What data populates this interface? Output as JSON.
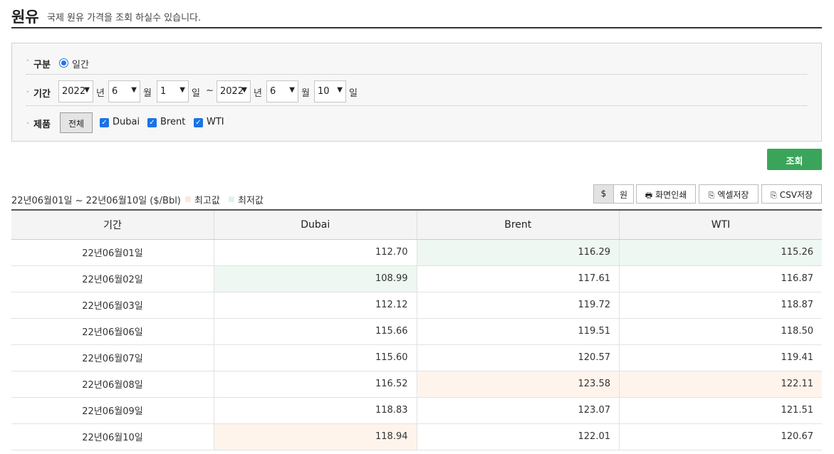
{
  "header": {
    "title": "원유",
    "description": "국제 원유 가격을 조회 하실수 있습니다."
  },
  "search": {
    "category_label": "구분",
    "category_value": "일간",
    "period_label": "기간",
    "start_year": "2022",
    "start_month": "6",
    "start_day": "1",
    "end_year": "2022",
    "end_month": "6",
    "end_day": "10",
    "unit_year": "년",
    "unit_month": "월",
    "unit_day": "일",
    "tilde": "~",
    "product_label": "제품",
    "all_button": "전체",
    "products": [
      "Dubai",
      "Brent",
      "WTI"
    ]
  },
  "submit_button": "조회",
  "summary": {
    "range": "22년06월01일 ~ 22년06월10일 ($/Bbl)",
    "max_legend": "최고값",
    "min_legend": "최저값"
  },
  "toolbar": {
    "dollar": "$",
    "won": "원",
    "print": "화면인쇄",
    "excel": "엑셀저장",
    "csv": "CSV저장"
  },
  "table": {
    "headers": [
      "기간",
      "Dubai",
      "Brent",
      "WTI"
    ],
    "rows": [
      [
        "22년06월01일",
        "112.70",
        "116.29",
        "115.26"
      ],
      [
        "22년06월02일",
        "108.99",
        "117.61",
        "116.87"
      ],
      [
        "22년06월03일",
        "112.12",
        "119.72",
        "118.87"
      ],
      [
        "22년06월06일",
        "115.66",
        "119.51",
        "118.50"
      ],
      [
        "22년06월07일",
        "115.60",
        "120.57",
        "119.41"
      ],
      [
        "22년06월08일",
        "116.52",
        "123.58",
        "122.11"
      ],
      [
        "22년06월09일",
        "118.83",
        "123.07",
        "121.51"
      ],
      [
        "22년06월10일",
        "118.94",
        "122.01",
        "120.67"
      ]
    ]
  },
  "colors": {
    "max_highlight": "#fef4ec",
    "min_highlight": "#eef7f1",
    "accent_green": "#3aa55a",
    "checkbox_blue": "#1a73e8"
  }
}
